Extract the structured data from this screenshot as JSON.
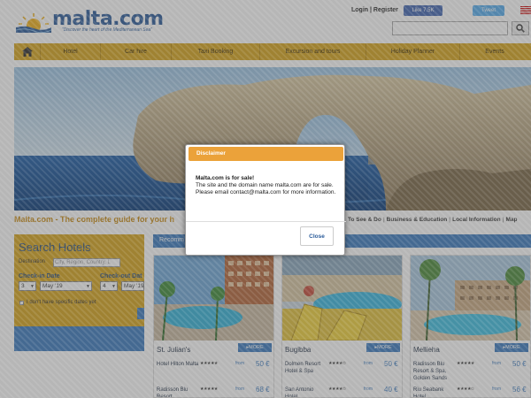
{
  "header": {
    "brand": "malta.com",
    "tagline": "\"Discover the heart of the Mediterranean Sea\"",
    "login_register": "Login | Register",
    "fb_like": "Like 7.5K",
    "tweet": "Tweet"
  },
  "nav": {
    "items": [
      "Hotel",
      "Car hire",
      "Taxi Booking",
      "Excursion and tours",
      "Holiday Planner",
      "Events"
    ]
  },
  "guide": {
    "title": "Malta.com - The complete guide for your h",
    "links": [
      "To See & Do",
      "Business & Education",
      "Local Information",
      "Map"
    ]
  },
  "search_hotels": {
    "title": "Search Hotels",
    "destination_label": "Destination",
    "destination_placeholder": "City, Region, Country, L",
    "checkin_label": "Check-in Date",
    "checkout_label": "Check-out Dat",
    "checkin_day": "3",
    "checkin_month": "May '19",
    "checkout_day": "4",
    "checkout_month": "May '19",
    "no_dates_label": "I don't have specific dates yet"
  },
  "recommended": {
    "title": "Recomm",
    "cards": [
      {
        "city": "St. Julian's",
        "more": "MORE",
        "rows": [
          {
            "name": "Hotel Hilton Malta",
            "stars": "★★★★★",
            "from": "from",
            "price": "50 €"
          },
          {
            "name": "Radisson Blu Resort",
            "stars": "★★★★★",
            "from": "from",
            "price": "68 €"
          }
        ]
      },
      {
        "city": "Bugibba",
        "more": "MORE",
        "rows": [
          {
            "name": "Dolmen Resort Hotel & Spa",
            "stars": "★★★★✩",
            "from": "from",
            "price": "50 €"
          },
          {
            "name": "San Antonio Hotel",
            "stars": "★★★★✩",
            "from": "from",
            "price": "40 €"
          }
        ]
      },
      {
        "city": "Mellieha",
        "more": "MORE",
        "rows": [
          {
            "name": "Radisson Blu Resort & Spa, Golden Sands",
            "stars": "★★★★★",
            "from": "from",
            "price": "50 €"
          },
          {
            "name": "Riu Seabank Hotel",
            "stars": "★★★★✩",
            "from": "from",
            "price": "56 €"
          }
        ]
      }
    ]
  },
  "modal": {
    "title": "Disclaimer",
    "heading": "Malta.com is for sale!",
    "body": "The site and the domain name malta.com are for sale. Please email contact@malta.com for more information.",
    "close": "Close"
  },
  "colors": {
    "nav_gold": "#d8a51c",
    "brand_blue": "#2a5b9a",
    "accent_blue": "#3c7bbf",
    "modal_orange": "#eba23a"
  }
}
